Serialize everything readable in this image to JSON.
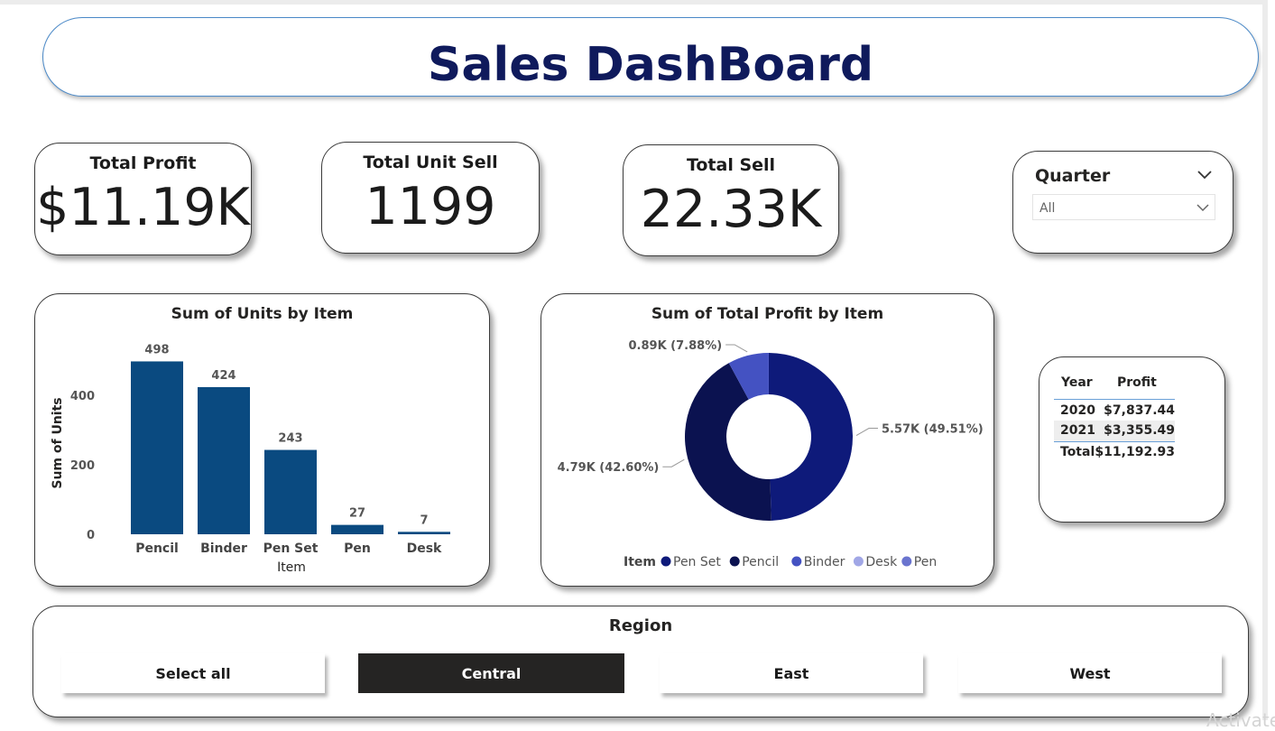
{
  "title": "Sales DashBoard",
  "kpis": {
    "total_profit": {
      "label": "Total Profit",
      "value": "$11.19K"
    },
    "total_unit_sell": {
      "label": "Total Unit Sell",
      "value": "1199"
    },
    "total_sell": {
      "label": "Total Sell",
      "value": "22.33K"
    }
  },
  "quarter_slicer": {
    "label": "Quarter",
    "selected": "All"
  },
  "units_chart": {
    "title": "Sum of Units by Item",
    "xlabel": "Item",
    "ylabel": "Sum of Units"
  },
  "profit_chart": {
    "title": "Sum of Total Profit by Item",
    "legend_title": "Item"
  },
  "chart_data": [
    {
      "type": "bar",
      "title": "Sum of Units by Item",
      "xlabel": "Item",
      "ylabel": "Sum of Units",
      "categories": [
        "Pencil",
        "Binder",
        "Pen Set",
        "Pen",
        "Desk"
      ],
      "values": [
        498,
        424,
        243,
        27,
        7
      ],
      "data_labels": [
        "498",
        "424",
        "243",
        "27",
        "7"
      ],
      "yticks": [
        "0",
        "200",
        "400"
      ],
      "ylim": [
        0,
        520
      ],
      "color": "#0a4a80",
      "grid": false
    },
    {
      "type": "pie",
      "subtype": "donut",
      "title": "Sum of Total Profit by Item",
      "legend_title": "Item",
      "legend_position": "bottom",
      "slices": [
        {
          "name": "Pen Set",
          "value": 49.51,
          "label": "5.57K (49.51%)",
          "color": "#0e1a7a"
        },
        {
          "name": "Pencil",
          "value": 42.6,
          "label": "4.79K (42.60%)",
          "color": "#0b1250"
        },
        {
          "name": "Binder",
          "value": 7.88,
          "label": "0.89K (7.88%)",
          "color": "#4452c2"
        },
        {
          "name": "Desk",
          "value": 0.005,
          "label": "",
          "color": "#a1a7e6"
        },
        {
          "name": "Pen",
          "value": 0.005,
          "label": "",
          "color": "#6a74cf"
        }
      ]
    }
  ],
  "year_table": {
    "headers": [
      "Year",
      "Profit"
    ],
    "rows": [
      [
        "2020",
        "$7,837.44"
      ],
      [
        "2021",
        "$3,355.49"
      ]
    ],
    "total": [
      "Total",
      "$11,192.93"
    ]
  },
  "region_slicer": {
    "title": "Region",
    "options": [
      "Select all",
      "Central",
      "East",
      "West"
    ],
    "selected": "Central"
  },
  "watermark": "Activate"
}
